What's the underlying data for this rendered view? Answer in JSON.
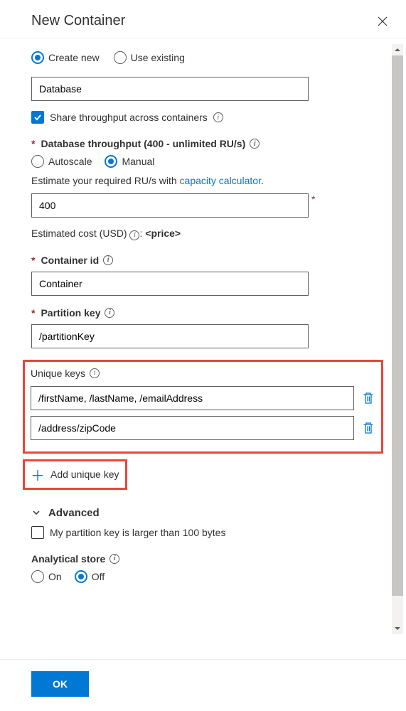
{
  "header": {
    "title": "New Container"
  },
  "db_mode": {
    "create": "Create new",
    "existing": "Use existing",
    "value": "Database"
  },
  "share": {
    "label": "Share throughput across containers"
  },
  "throughput": {
    "label": "Database throughput (400 - unlimited RU/s)",
    "autoscale": "Autoscale",
    "manual": "Manual",
    "estimate_prefix": "Estimate your required RU/s with ",
    "estimate_link": "capacity calculator",
    "value": "400",
    "cost_prefix": "Estimated cost (USD) ",
    "cost_value": "<price>"
  },
  "container": {
    "label": "Container id",
    "value": "Container"
  },
  "partition": {
    "label": "Partition key",
    "value": "/partitionKey"
  },
  "unique": {
    "label": "Unique keys",
    "rows": [
      "/firstName, /lastName, /emailAddress",
      "/address/zipCode"
    ],
    "add_label": "Add unique key"
  },
  "advanced": {
    "title": "Advanced",
    "large_pk": "My partition key is larger than 100 bytes"
  },
  "analytical": {
    "label": "Analytical store",
    "on": "On",
    "off": "Off"
  },
  "footer": {
    "ok": "OK"
  }
}
